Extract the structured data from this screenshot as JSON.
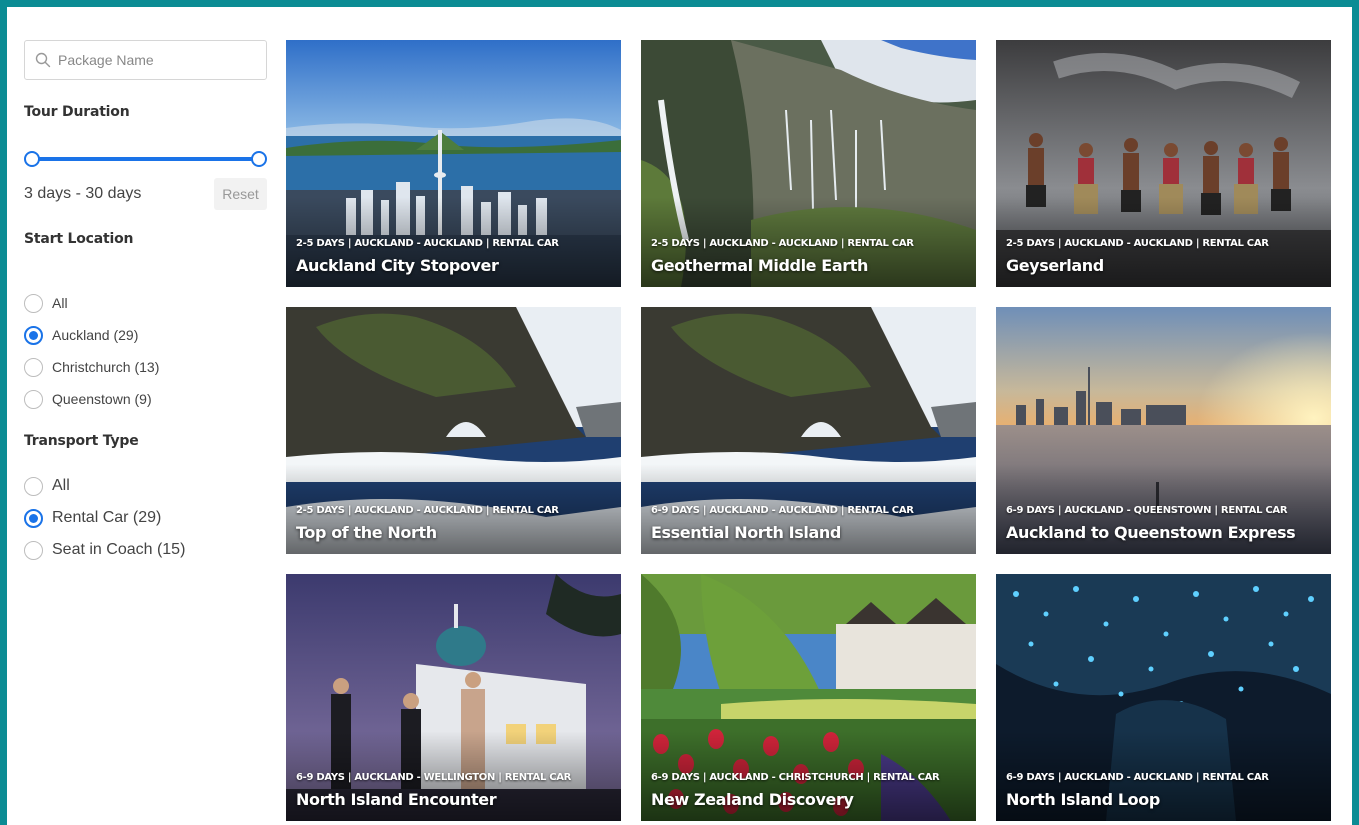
{
  "search": {
    "placeholder": "Package Name",
    "value": ""
  },
  "filters": {
    "duration": {
      "heading": "Tour Duration",
      "range_text": "3 days - 30 days",
      "reset_label": "Reset"
    },
    "start_location": {
      "heading": "Start Location",
      "options": [
        {
          "label": "All",
          "checked": false
        },
        {
          "label": "Auckland (29)",
          "checked": true
        },
        {
          "label": "Christchurch (13)",
          "checked": false
        },
        {
          "label": "Queenstown (9)",
          "checked": false
        }
      ]
    },
    "transport": {
      "heading": "Transport Type",
      "options": [
        {
          "label": "All",
          "checked": false
        },
        {
          "label": "Rental Car (29)",
          "checked": true
        },
        {
          "label": "Seat in Coach (15)",
          "checked": false
        }
      ]
    }
  },
  "colors": {
    "frame": "#0b8c94",
    "accent": "#1a73e8"
  },
  "packages": [
    {
      "meta": "2-5 DAYS | AUCKLAND - AUCKLAND | RENTAL CAR",
      "title": "Auckland City Stopover",
      "scene": "city-harbour"
    },
    {
      "meta": "2-5 DAYS | AUCKLAND - AUCKLAND | RENTAL CAR",
      "title": "Geothermal Middle Earth",
      "scene": "waterfall-cliffs"
    },
    {
      "meta": "2-5 DAYS | AUCKLAND - AUCKLAND | RENTAL CAR",
      "title": "Geyserland",
      "scene": "maori-performers"
    },
    {
      "meta": "2-5 DAYS | AUCKLAND - AUCKLAND | RENTAL CAR",
      "title": "Top of the North",
      "scene": "rock-arch"
    },
    {
      "meta": "6-9 DAYS | AUCKLAND - AUCKLAND | RENTAL CAR",
      "title": "Essential North Island",
      "scene": "rock-arch"
    },
    {
      "meta": "6-9 DAYS | AUCKLAND - QUEENSTOWN | RENTAL CAR",
      "title": "Auckland to Queenstown Express",
      "scene": "sunset-skyline"
    },
    {
      "meta": "6-9 DAYS | AUCKLAND - WELLINGTON | RENTAL CAR",
      "title": "North Island Encounter",
      "scene": "art-deco-night"
    },
    {
      "meta": "6-9 DAYS | AUCKLAND - CHRISTCHURCH | RENTAL CAR",
      "title": "New Zealand Discovery",
      "scene": "tulip-garden"
    },
    {
      "meta": "6-9 DAYS | AUCKLAND - AUCKLAND | RENTAL CAR",
      "title": "North Island Loop",
      "scene": "glowworm-cave"
    }
  ]
}
